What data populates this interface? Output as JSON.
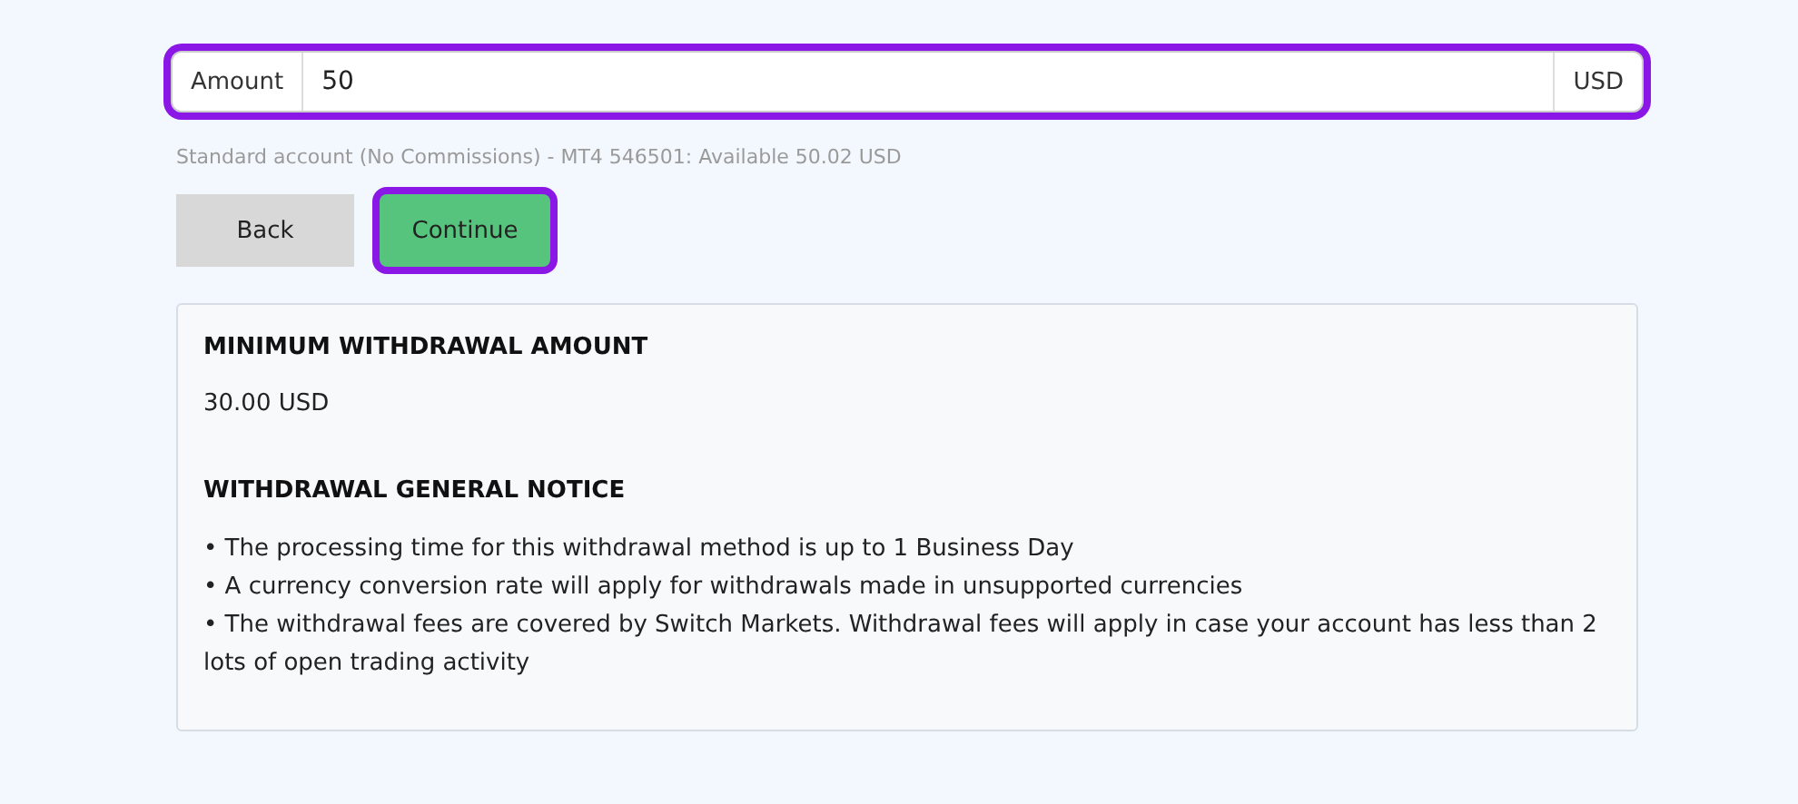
{
  "amount_field": {
    "label": "Amount",
    "value": "50",
    "currency": "USD",
    "highlighted": true
  },
  "account_info": "Standard account (No Commissions) - MT4 546501: Available 50.02 USD",
  "buttons": [
    {
      "label": "Back",
      "kind": "secondary",
      "highlighted": false
    },
    {
      "label": "Continue",
      "kind": "primary",
      "highlighted": true
    }
  ],
  "notice": {
    "min_heading": "MINIMUM WITHDRAWAL AMOUNT",
    "min_value": "30.00 USD",
    "general_heading": "WITHDRAWAL GENERAL NOTICE",
    "items": [
      "• The processing time for this withdrawal method is up to 1 Business Day",
      "• A currency conversion rate will apply for withdrawals made in unsupported currencies",
      "• The withdrawal fees are covered by Switch Markets. Withdrawal fees will apply in case your account has less than 2 lots of open trading activity"
    ]
  }
}
